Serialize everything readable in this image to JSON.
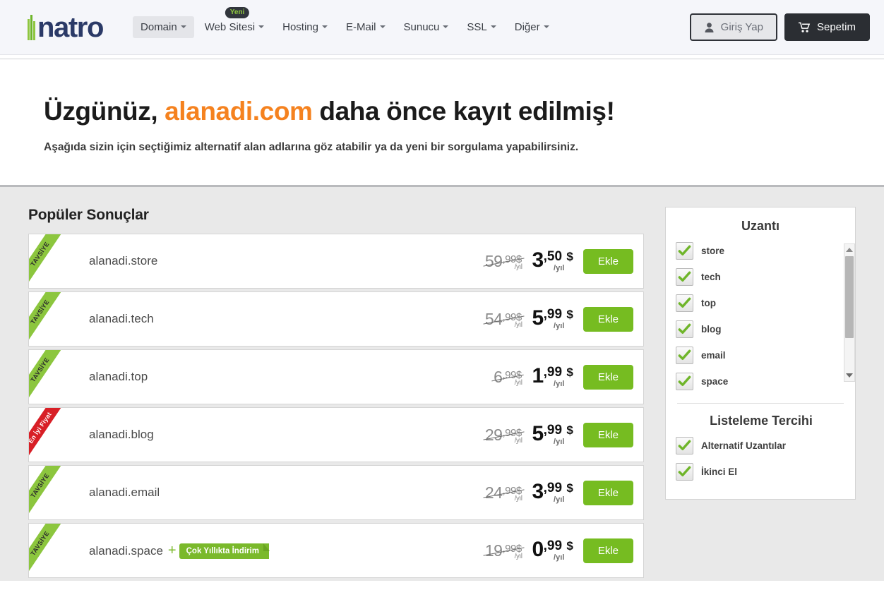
{
  "header": {
    "logo_text": "natro",
    "nav": [
      {
        "label": "Domain",
        "active": true,
        "badge": null
      },
      {
        "label": "Web Sitesi",
        "active": false,
        "badge": "Yeni"
      },
      {
        "label": "Hosting",
        "active": false,
        "badge": null
      },
      {
        "label": "E-Mail",
        "active": false,
        "badge": null
      },
      {
        "label": "Sunucu",
        "active": false,
        "badge": null
      },
      {
        "label": "SSL",
        "active": false,
        "badge": null
      },
      {
        "label": "Diğer",
        "active": false,
        "badge": null
      }
    ],
    "login_label": "Giriş Yap",
    "cart_label": "Sepetim"
  },
  "hero": {
    "title_prefix": "Üzgünüz, ",
    "title_domain": "alanadi.com",
    "title_suffix": " daha önce kayıt edilmiş!",
    "subtitle": "Aşağıda sizin için seçtiğimiz alternatif alan adlarına göz atabilir ya da yeni bir sorgulama yapabilirsiniz."
  },
  "results": {
    "title": "Popüler Sonuçlar",
    "add_label": "Ekle",
    "ribbon_recommended": "TAVSİYE",
    "ribbon_best_price": "En İyi Fiyat",
    "multiyear_badge": "Çok Yıllıkta İndirim",
    "period_label": "/yıl",
    "currency": "$",
    "rows": [
      {
        "domain": "alanadi.store",
        "ribbon": "TAVSİYE",
        "ribbon_type": "green",
        "old_int": "59",
        "old_dec": ",99",
        "new_int": "3",
        "new_dec": ",50",
        "multiyear": false
      },
      {
        "domain": "alanadi.tech",
        "ribbon": "TAVSİYE",
        "ribbon_type": "green",
        "old_int": "54",
        "old_dec": ",99",
        "new_int": "5",
        "new_dec": ",99",
        "multiyear": false
      },
      {
        "domain": "alanadi.top",
        "ribbon": "TAVSİYE",
        "ribbon_type": "green",
        "old_int": "6",
        "old_dec": ",99",
        "new_int": "1",
        "new_dec": ",99",
        "multiyear": false
      },
      {
        "domain": "alanadi.blog",
        "ribbon": "En İyi Fiyat",
        "ribbon_type": "red",
        "old_int": "29",
        "old_dec": ",99",
        "new_int": "5",
        "new_dec": ",99",
        "multiyear": false
      },
      {
        "domain": "alanadi.email",
        "ribbon": "TAVSİYE",
        "ribbon_type": "green",
        "old_int": "24",
        "old_dec": ",99",
        "new_int": "3",
        "new_dec": ",99",
        "multiyear": false
      },
      {
        "domain": "alanadi.space",
        "ribbon": "TAVSİYE",
        "ribbon_type": "green",
        "old_int": "19",
        "old_dec": ",99",
        "new_int": "0",
        "new_dec": ",99",
        "multiyear": true
      }
    ]
  },
  "sidebar": {
    "extensions_title": "Uzantı",
    "extensions": [
      {
        "label": "store",
        "checked": true
      },
      {
        "label": "tech",
        "checked": true
      },
      {
        "label": "top",
        "checked": true
      },
      {
        "label": "blog",
        "checked": true
      },
      {
        "label": "email",
        "checked": true
      },
      {
        "label": "space",
        "checked": true
      }
    ],
    "listing_title": "Listeleme Tercihi",
    "listing_options": [
      {
        "label": "Alternatif Uzantılar",
        "checked": true
      },
      {
        "label": "İkinci El",
        "checked": true
      }
    ]
  },
  "colors": {
    "accent_orange": "#f5821f",
    "green": "#76bc21",
    "ribbon_green": "#8cc63e",
    "ribbon_red": "#d81f26",
    "navy": "#2b3a67"
  }
}
